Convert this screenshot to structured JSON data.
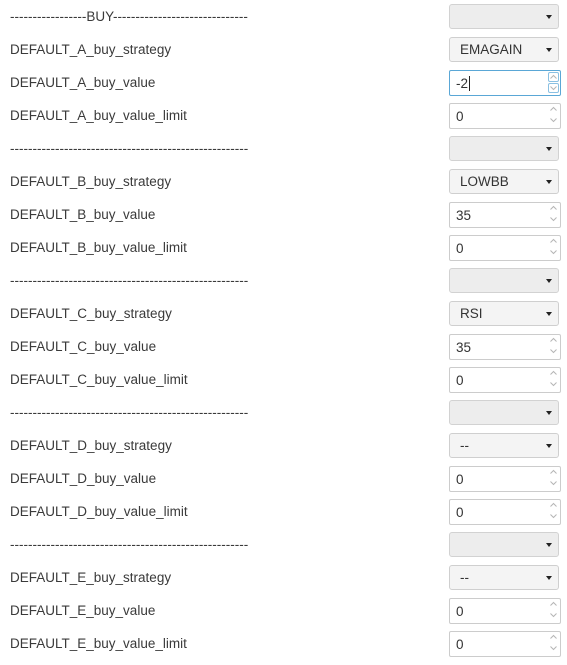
{
  "rows": [
    {
      "label": "-----------------BUY------------------------------",
      "control": "select",
      "value": ""
    },
    {
      "label": "DEFAULT_A_buy_strategy",
      "control": "select",
      "value": "EMAGAIN"
    },
    {
      "label": "DEFAULT_A_buy_value",
      "control": "number",
      "value": "-2",
      "focused": true
    },
    {
      "label": "DEFAULT_A_buy_value_limit",
      "control": "number",
      "value": "0"
    },
    {
      "label": "-----------------------------------------------------",
      "control": "select",
      "value": ""
    },
    {
      "label": "DEFAULT_B_buy_strategy",
      "control": "select",
      "value": "LOWBB"
    },
    {
      "label": "DEFAULT_B_buy_value",
      "control": "number",
      "value": "35"
    },
    {
      "label": "DEFAULT_B_buy_value_limit",
      "control": "number",
      "value": "0"
    },
    {
      "label": "-----------------------------------------------------",
      "control": "select",
      "value": ""
    },
    {
      "label": "DEFAULT_C_buy_strategy",
      "control": "select",
      "value": "RSI"
    },
    {
      "label": "DEFAULT_C_buy_value",
      "control": "number",
      "value": "35"
    },
    {
      "label": "DEFAULT_C_buy_value_limit",
      "control": "number",
      "value": "0"
    },
    {
      "label": "-----------------------------------------------------",
      "control": "select",
      "value": ""
    },
    {
      "label": "DEFAULT_D_buy_strategy",
      "control": "select",
      "value": "--"
    },
    {
      "label": "DEFAULT_D_buy_value",
      "control": "number",
      "value": "0"
    },
    {
      "label": "DEFAULT_D_buy_value_limit",
      "control": "number",
      "value": "0"
    },
    {
      "label": "-----------------------------------------------------",
      "control": "select",
      "value": ""
    },
    {
      "label": "DEFAULT_E_buy_strategy",
      "control": "select",
      "value": "--"
    },
    {
      "label": "DEFAULT_E_buy_value",
      "control": "number",
      "value": "0"
    },
    {
      "label": "DEFAULT_E_buy_value_limit",
      "control": "number",
      "value": "0"
    }
  ]
}
